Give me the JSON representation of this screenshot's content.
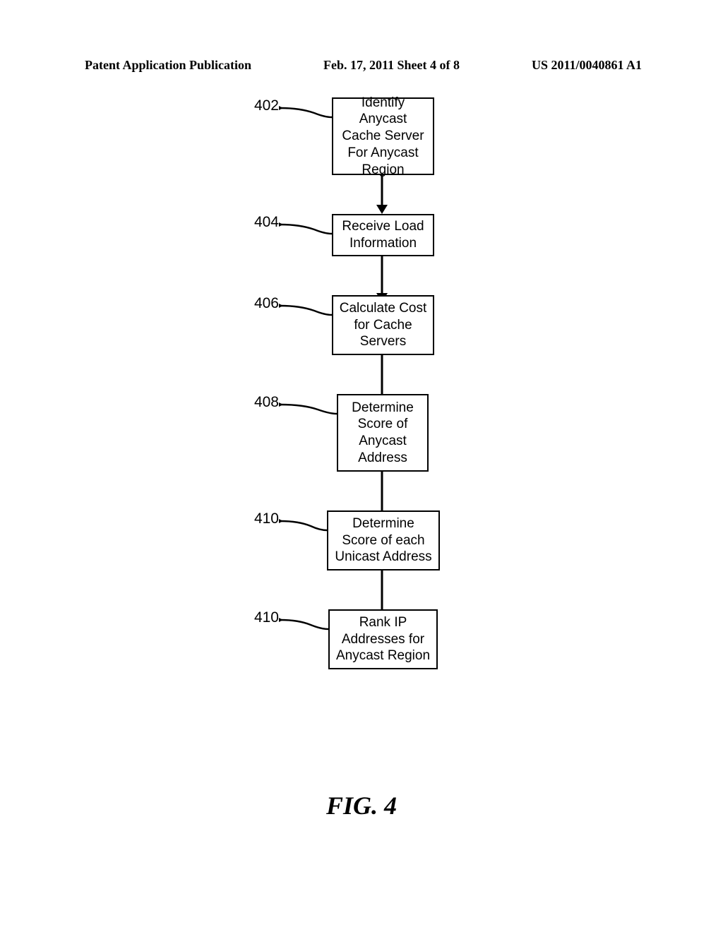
{
  "header": {
    "left": "Patent Application Publication",
    "center": "Feb. 17, 2011  Sheet 4 of 8",
    "right": "US 2011/0040861 A1"
  },
  "steps": [
    {
      "ref": "402",
      "text": "Identify Anycast Cache Server For Anycast Region"
    },
    {
      "ref": "404",
      "text": "Receive Load Information"
    },
    {
      "ref": "406",
      "text": "Calculate Cost for Cache Servers"
    },
    {
      "ref": "408",
      "text": "Determine Score of Anycast Address"
    },
    {
      "ref": "410",
      "text": "Determine Score of each Unicast Address"
    },
    {
      "ref": "410",
      "text": "Rank IP Addresses for Anycast Region"
    }
  ],
  "figure_label": "FIG. 4"
}
